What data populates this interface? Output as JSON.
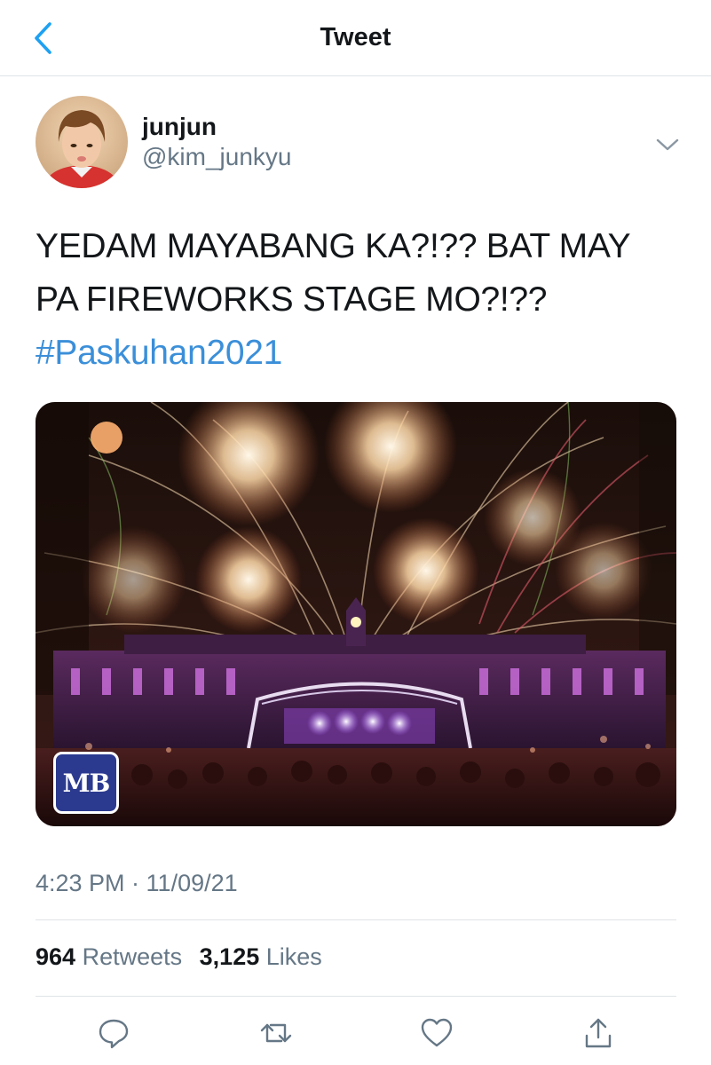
{
  "nav": {
    "title": "Tweet",
    "back_icon": "chevron-left-icon"
  },
  "author": {
    "display_name": "junjun",
    "handle": "@kim_junkyu",
    "menu_icon": "chevron-down-icon"
  },
  "tweet": {
    "text_lines": [
      "YEDAM MAYABANG KA?!?? BAT MAY",
      "PA FIREWORKS STAGE MO?!??"
    ],
    "hashtag": "#Paskuhan2021"
  },
  "media": {
    "badge": "MB"
  },
  "meta": {
    "timestamp": "4:23 PM · 11/09/21"
  },
  "stats": {
    "retweets_count": "964",
    "retweets_label": "Retweets",
    "likes_count": "3,125",
    "likes_label": "Likes"
  },
  "actions": [
    "reply-icon",
    "retweet-icon",
    "like-icon",
    "share-icon"
  ],
  "colors": {
    "link": "#3b8fd9",
    "accent": "#1da1f2",
    "muted": "#657786",
    "text": "#14171a",
    "divider": "#dfe3e6"
  }
}
